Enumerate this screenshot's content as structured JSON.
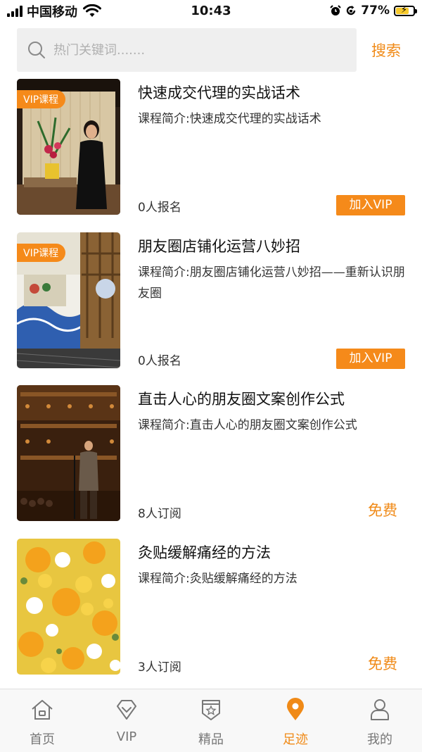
{
  "status_bar": {
    "carrier": "中国移动",
    "time": "10:43",
    "battery": "77%",
    "battery_level": 0.77
  },
  "search": {
    "placeholder": "热门关键词.......",
    "button_label": "搜索"
  },
  "courses": [
    {
      "tag": "VIP课程",
      "title": "快速成交代理的实战话术",
      "desc": "课程简介:快速成交代理的实战话术",
      "count": "0人报名",
      "action": "加入VIP"
    },
    {
      "tag": "VIP课程",
      "title": "朋友圈店铺化运营八妙招",
      "desc": "课程简介:朋友圈店铺化运营八妙招——重新认识朋友圈",
      "count": "0人报名",
      "action": "加入VIP"
    },
    {
      "title": "直击人心的朋友圈文案创作公式",
      "desc": "课程简介:直击人心的朋友圈文案创作公式",
      "count": "8人订阅",
      "action": "免费"
    },
    {
      "title": "灸贴缓解痛经的方法",
      "desc": "课程简介:灸贴缓解痛经的方法",
      "count": "3人订阅",
      "action": "免费"
    }
  ],
  "tab_bar": {
    "items": [
      {
        "label": "首页",
        "icon": "home-icon"
      },
      {
        "label": "VIP",
        "icon": "diamond-icon"
      },
      {
        "label": "精品",
        "icon": "star-badge-icon"
      },
      {
        "label": "足迹",
        "icon": "location-pin-icon",
        "active": true
      },
      {
        "label": "我的",
        "icon": "user-icon"
      }
    ]
  },
  "colors": {
    "accent": "#f08a17",
    "vip_tag": "#f58a1a",
    "search_bg": "#efefef"
  }
}
